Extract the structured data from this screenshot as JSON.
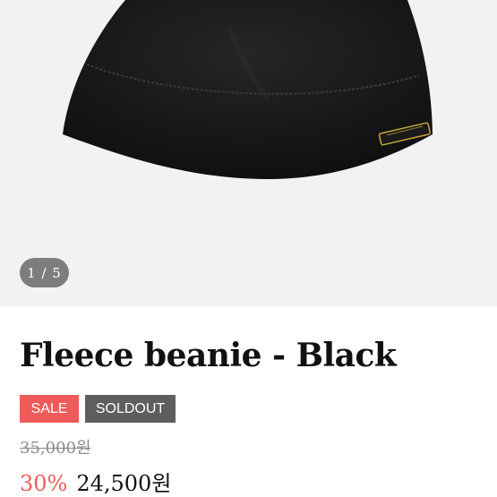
{
  "gallery": {
    "image_alt": "Fleece beanie - Black product photo",
    "page_indicator": "1 / 5",
    "colors": {
      "background": "#f2f2f2",
      "indicator": "#7d7d7d",
      "product": "#141414",
      "label": "#c8a63a"
    }
  },
  "product": {
    "title": "Fleece beanie - Black",
    "badges": {
      "sale": "SALE",
      "soldout": "SOLDOUT"
    },
    "original_price": "35,000원",
    "discount": "30%",
    "sale_price": "24,500원",
    "colors": {
      "sale_badge": "#ef5b5b",
      "soldout_badge": "#5e5e5e",
      "discount_text": "#ef5b5b"
    }
  }
}
